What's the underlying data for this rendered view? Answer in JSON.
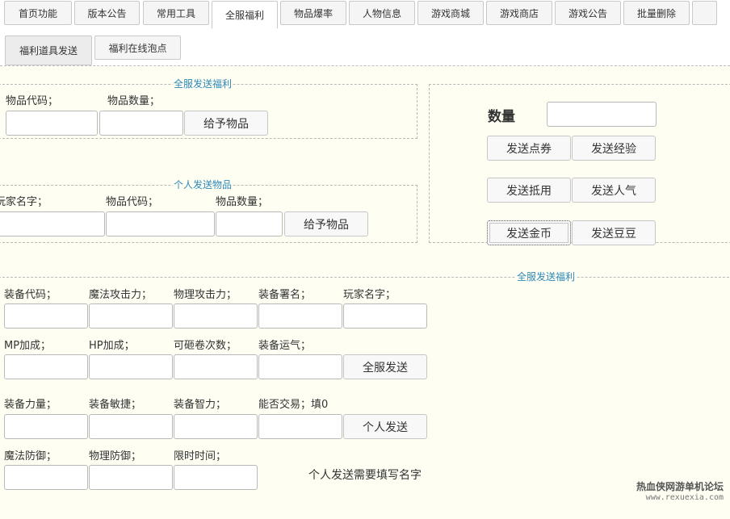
{
  "nav": {
    "tabs": [
      "首页功能",
      "版本公告",
      "常用工具",
      "全服福利",
      "物品爆率",
      "人物信息",
      "游戏商城",
      "游戏商店",
      "游戏公告",
      "批量删除",
      ""
    ],
    "active": "全服福利"
  },
  "subnav": {
    "tabs": [
      "福利道具发送",
      "福利在线泡点"
    ],
    "active": "福利道具发送"
  },
  "item_all": {
    "legend": "全服发送福利",
    "item_code_label": "物品代码；",
    "item_qty_label": "物品数量；",
    "give_button": "给予物品"
  },
  "item_personal": {
    "legend": "个人发送物品",
    "player_name_label": "玩家名字；",
    "item_code_label": "物品代码；",
    "item_qty_label": "物品数量；",
    "give_button": "给予物品"
  },
  "rewards": {
    "qty_label": "数量",
    "send_points": "发送点券",
    "send_exp": "发送经验",
    "send_voucher": "发送抵用",
    "send_popularity": "发送人气",
    "send_gold": "发送金币",
    "send_beans": "发送豆豆"
  },
  "equip": {
    "legend": "全服发送福利",
    "equip_code": "装备代码；",
    "magic_attack": "魔法攻击力；",
    "physical_attack": "物理攻击力；",
    "equip_sign": "装备署名；",
    "player_name": "玩家名字；",
    "mp_bonus": "MP加成；",
    "hp_bonus": "HP加成；",
    "scroll_count": "可砸卷次数；",
    "equip_luck": "装备运气；",
    "send_all_button": "全服发送",
    "equip_str": "装备力量；",
    "equip_dex": "装备敏捷；",
    "equip_int": "装备智力；",
    "tradable": "能否交易；填0",
    "send_personal_button": "个人发送",
    "magic_def": "魔法防御；",
    "physical_def": "物理防御；",
    "time_limit": "限时时间；",
    "note": "个人发送需要填写名字"
  },
  "watermark": {
    "line1": "热血侠网游单机论坛",
    "line2": "www.rexuexia.com"
  }
}
